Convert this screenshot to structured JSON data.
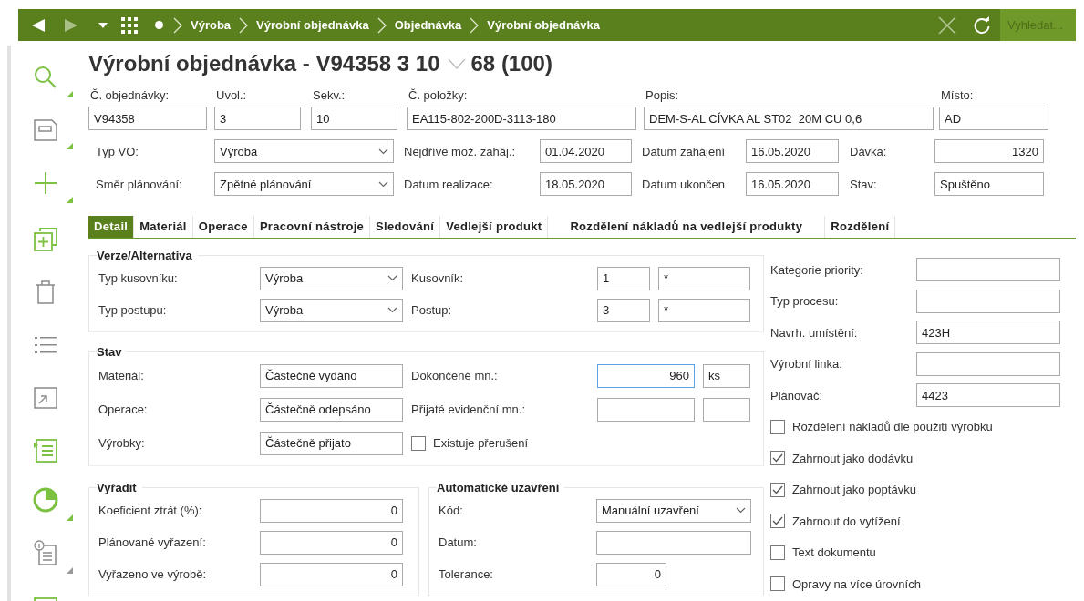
{
  "nav": {
    "crumbs": [
      "Výroba",
      "Výrobní objednávka",
      "Objednávka",
      "Výrobní objednávka"
    ],
    "search": {
      "placeholder": "Vyhledat..."
    }
  },
  "title": {
    "main": "Výrobní objednávka - V94358 3 10",
    "suffix": "68 (100)"
  },
  "header": {
    "top": [
      {
        "label": "Č. objednávky:",
        "value": "V94358"
      },
      {
        "label": "Uvol.:",
        "value": "3"
      },
      {
        "label": "Sekv.:",
        "value": "10"
      },
      {
        "label": "Č. položky:",
        "value": "EA115-802-200D-3113-180"
      },
      {
        "label": "Popis:",
        "value": "DEM-S-AL CÍVKA AL ST02  20M CU 0,6"
      },
      {
        "label": "Místo:",
        "value": "AD"
      }
    ],
    "rows": [
      [
        {
          "label": "Typ VO:",
          "kind": "select",
          "value": "Výroba"
        },
        {
          "label": "Nejdříve mož. zaháj.:",
          "kind": "text",
          "value": "01.04.2020"
        },
        {
          "label": "Datum zahájení",
          "kind": "text",
          "value": "16.05.2020"
        },
        {
          "label": "Dávka:",
          "kind": "number",
          "value": "1320"
        }
      ],
      [
        {
          "label": "Směr plánování:",
          "kind": "select",
          "value": "Zpětné plánování"
        },
        {
          "label": "Datum realizace:",
          "kind": "text",
          "value": "18.05.2020"
        },
        {
          "label": "Datum ukončen",
          "kind": "text",
          "value": "16.05.2020"
        },
        {
          "label": "Stav:",
          "kind": "text",
          "value": "Spuštěno"
        }
      ]
    ]
  },
  "tabs": [
    {
      "label": "Detail",
      "selected": true
    },
    {
      "label": "Materiál",
      "selected": false
    },
    {
      "label": "Operace",
      "selected": false
    },
    {
      "label": "Pracovní nástroje",
      "selected": false
    },
    {
      "label": "Sledování",
      "selected": false
    },
    {
      "label": "Vedlejší produkt",
      "selected": false
    },
    {
      "label": "Rozdělení nákladů na vedlejší produkty",
      "selected": false
    },
    {
      "label": "Rozdělení",
      "selected": false
    }
  ],
  "detail": {
    "version": {
      "title": "Verze/Alternativa",
      "rows": [
        [
          {
            "kind": "label",
            "text": "Typ kusovníku:"
          },
          {
            "kind": "select",
            "value": "Výroba"
          },
          {
            "kind": "label",
            "text": "Kusovník:"
          },
          {
            "kind": "text",
            "value": "1"
          },
          {
            "kind": "text",
            "value": "*"
          }
        ],
        [
          {
            "kind": "label",
            "text": "Typ postupu:"
          },
          {
            "kind": "select",
            "value": "Výroba"
          },
          {
            "kind": "label",
            "text": "Postup:"
          },
          {
            "kind": "text",
            "value": "3"
          },
          {
            "kind": "text",
            "value": "*"
          }
        ]
      ]
    },
    "state": {
      "title": "Stav",
      "rows": [
        [
          {
            "kind": "label",
            "text": "Materiál:"
          },
          {
            "kind": "text",
            "value": "Částečně vydáno"
          },
          {
            "kind": "label",
            "text": "Dokončené mn.:"
          },
          {
            "kind": "number",
            "value": "960",
            "focused": true
          },
          {
            "kind": "text",
            "value": "ks"
          }
        ],
        [
          {
            "kind": "label",
            "text": "Operace:"
          },
          {
            "kind": "text",
            "value": "Částečně odepsáno"
          },
          {
            "kind": "label",
            "text": "Přijaté evidenční mn.:"
          },
          {
            "kind": "text"
          },
          {
            "kind": "text"
          }
        ],
        [
          {
            "kind": "label",
            "text": "Výrobky:"
          },
          {
            "kind": "text",
            "value": "Částečně přijato"
          },
          {
            "kind": "checkbox",
            "label": "Existuje přerušení",
            "checked": false
          }
        ]
      ]
    },
    "scrap": {
      "title": "Vyřadit",
      "rows": [
        [
          {
            "kind": "label",
            "text": "Koeficient ztrát (%):"
          },
          {
            "kind": "number",
            "value": "0"
          }
        ],
        [
          {
            "kind": "label",
            "text": "Plánované vyřazení:"
          },
          {
            "kind": "number",
            "value": "0"
          }
        ],
        [
          {
            "kind": "label",
            "text": "Vyřazeno ve výrobě:"
          },
          {
            "kind": "number",
            "value": "0"
          }
        ]
      ]
    },
    "auto_close": {
      "title": "Automatické uzavření",
      "rows": [
        [
          {
            "kind": "label",
            "text": "Kód:"
          },
          {
            "kind": "select",
            "value": "Manuální uzavření"
          }
        ],
        [
          {
            "kind": "label",
            "text": "Datum:"
          },
          {
            "kind": "text"
          }
        ],
        [
          {
            "kind": "label",
            "text": "Tolerance:"
          },
          {
            "kind": "number",
            "value": "0"
          }
        ]
      ]
    },
    "side": {
      "rows": [
        [
          {
            "kind": "label",
            "text": "Kategorie priority:"
          },
          {
            "kind": "text"
          }
        ],
        [
          {
            "kind": "label",
            "text": "Typ procesu:"
          },
          {
            "kind": "text"
          }
        ],
        [
          {
            "kind": "label",
            "text": "Navrh. umístění:"
          },
          {
            "kind": "text",
            "value": "423H"
          }
        ],
        [
          {
            "kind": "label",
            "text": "Výrobní linka:"
          },
          {
            "kind": "text"
          }
        ],
        [
          {
            "kind": "label",
            "text": "Plánovač:"
          },
          {
            "kind": "text",
            "value": "4423"
          }
        ],
        [
          {
            "kind": "checkbox",
            "label": "Rozdělení nákladů dle použití výrobku",
            "checked": false
          }
        ],
        [
          {
            "kind": "checkbox",
            "label": "Zahrnout jako dodávku",
            "checked": true
          }
        ],
        [
          {
            "kind": "checkbox",
            "label": "Zahrnout jako poptávku",
            "checked": true
          }
        ],
        [
          {
            "kind": "checkbox",
            "label": "Zahrnout do vytížení",
            "checked": true
          }
        ],
        [
          {
            "kind": "checkbox",
            "label": "Text dokumentu",
            "checked": false
          }
        ],
        [
          {
            "kind": "checkbox",
            "label": "Opravy na více úrovních",
            "checked": false
          }
        ]
      ]
    }
  }
}
